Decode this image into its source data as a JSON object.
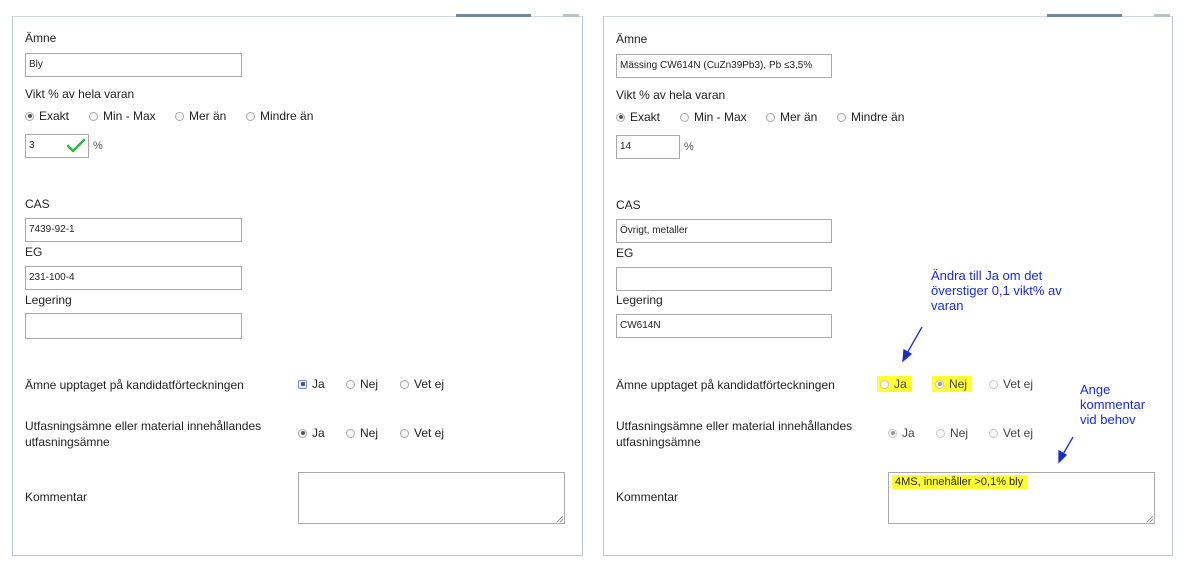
{
  "left": {
    "amne_label": "Ämne",
    "amne_value": "Bly",
    "vikt_label": "Vikt % av hela varan",
    "weight_options": [
      "Exakt",
      "Min - Max",
      "Mer än",
      "Mindre än"
    ],
    "weight_value": "3",
    "percent": "%",
    "cas_label": "CAS",
    "cas_value": "7439-92-1",
    "eg_label": "EG",
    "eg_value": "231-100-4",
    "legering_label": "Legering",
    "legering_value": "",
    "kandidat_label": "Ämne upptaget på kandidatförteckningen",
    "kandidat_options": [
      "Ja",
      "Nej",
      "Vet ej"
    ],
    "utfasning_label_line1": "Utfasningsämne eller material innehållandes",
    "utfasning_label_line2": "utfasningsämne",
    "utfasning_options": [
      "Ja",
      "Nej",
      "Vet ej"
    ],
    "kommentar_label": "Kommentar",
    "kommentar_value": ""
  },
  "right": {
    "amne_label": "Ämne",
    "amne_value": "Mässing CW614N (CuZn39Pb3), Pb ≤3,5%",
    "vikt_label": "Vikt % av hela varan",
    "weight_options": [
      "Exakt",
      "Min - Max",
      "Mer än",
      "Mindre än"
    ],
    "weight_value": "14",
    "percent": "%",
    "cas_label": "CAS",
    "cas_value": "Övrigt, metaller",
    "eg_label": "EG",
    "eg_value": "",
    "legering_label": "Legering",
    "legering_value": "CW614N",
    "kandidat_label": "Ämne upptaget på kandidatförteckningen",
    "kandidat_options": [
      "Ja",
      "Nej",
      "Vet ej"
    ],
    "utfasning_label_line1": "Utfasningsämne eller material innehållandes",
    "utfasning_label_line2": "utfasningsämne",
    "utfasning_options": [
      "Ja",
      "Nej",
      "Vet ej"
    ],
    "kommentar_label": "Kommentar",
    "kommentar_value": "4MS, innehåller >0,1% bly"
  },
  "annotations": {
    "note1_line1": "Ändra till Ja om det",
    "note1_line2": "överstiger 0,1 vikt% av",
    "note1_line3": "varan",
    "note2_line1": "Ange",
    "note2_line2": "kommentar",
    "note2_line3": "vid behov"
  },
  "colors": {
    "highlight": "#ffff33",
    "annotation": "#1a2ec8",
    "valid_check": "#2fb54a"
  }
}
